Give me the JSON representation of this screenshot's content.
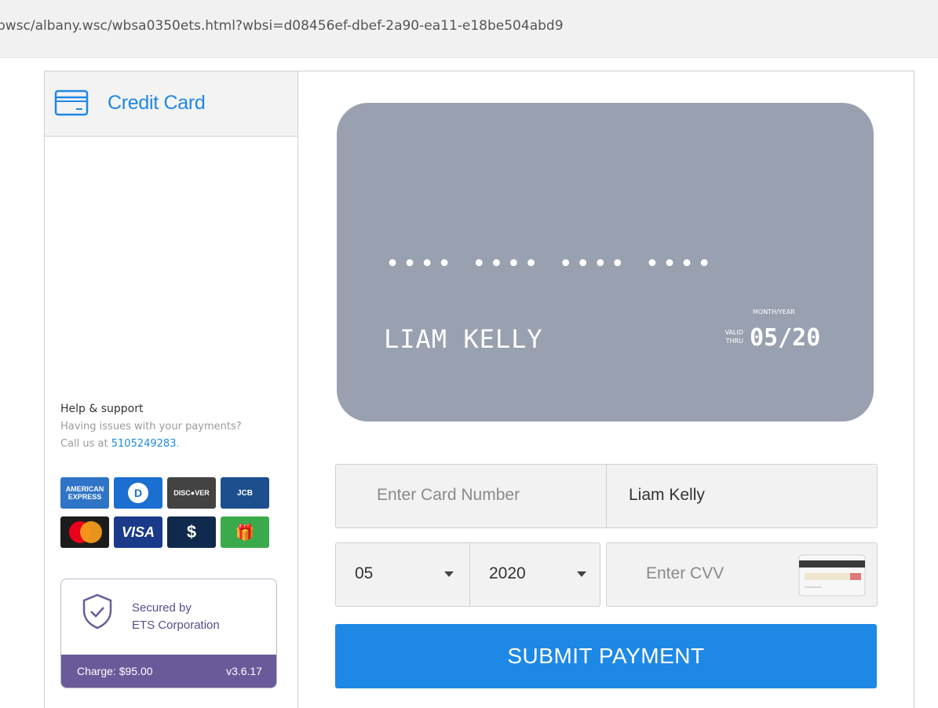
{
  "browser": {
    "url": "bwsc/albany.wsc/wbsa0350ets.html?wbsi=d08456ef-dbef-2a90-ea11-e18be504abd9"
  },
  "payment_tabs": {
    "credit_card_label": "Credit Card"
  },
  "card_preview": {
    "number_mask": "•••• •••• •••• ••••",
    "holder_name": "LIAM KELLY",
    "month_year_label": "MONTH/YEAR",
    "valid_thru_label_1": "VALID",
    "valid_thru_label_2": "THRU",
    "expiry": "05/20",
    "color": "#99a0b0"
  },
  "form": {
    "card_number_placeholder": "Enter Card Number",
    "card_number_value": "",
    "name_value": "Liam Kelly",
    "month_selected": "05",
    "year_selected": "2020",
    "cvv_placeholder": "Enter CVV",
    "submit_label": "SUBMIT PAYMENT"
  },
  "help": {
    "title": "Help & support",
    "line1": "Having issues with your payments?",
    "line2_prefix": "Call us at ",
    "phone": "5105249283",
    "line2_suffix": "."
  },
  "card_logos": [
    {
      "name": "amex-logo",
      "text": "AMERICAN EXPRESS"
    },
    {
      "name": "diners-logo",
      "text": "D"
    },
    {
      "name": "discover-logo",
      "text": "DISC●VER"
    },
    {
      "name": "jcb-logo",
      "text": "JCB"
    },
    {
      "name": "mastercard-logo",
      "text": "mastercard"
    },
    {
      "name": "visa-logo",
      "text": "VISA"
    },
    {
      "name": "other-card-logo",
      "text": "$"
    },
    {
      "name": "gift-card-logo",
      "text": "🎁"
    }
  ],
  "security": {
    "line1": "Secured by",
    "line2": "ETS Corporation",
    "charge": "Charge: $95.00",
    "version": "v3.6.17"
  },
  "colors": {
    "accent": "#1e88e5",
    "charge_bar": "#6a5a9a"
  }
}
